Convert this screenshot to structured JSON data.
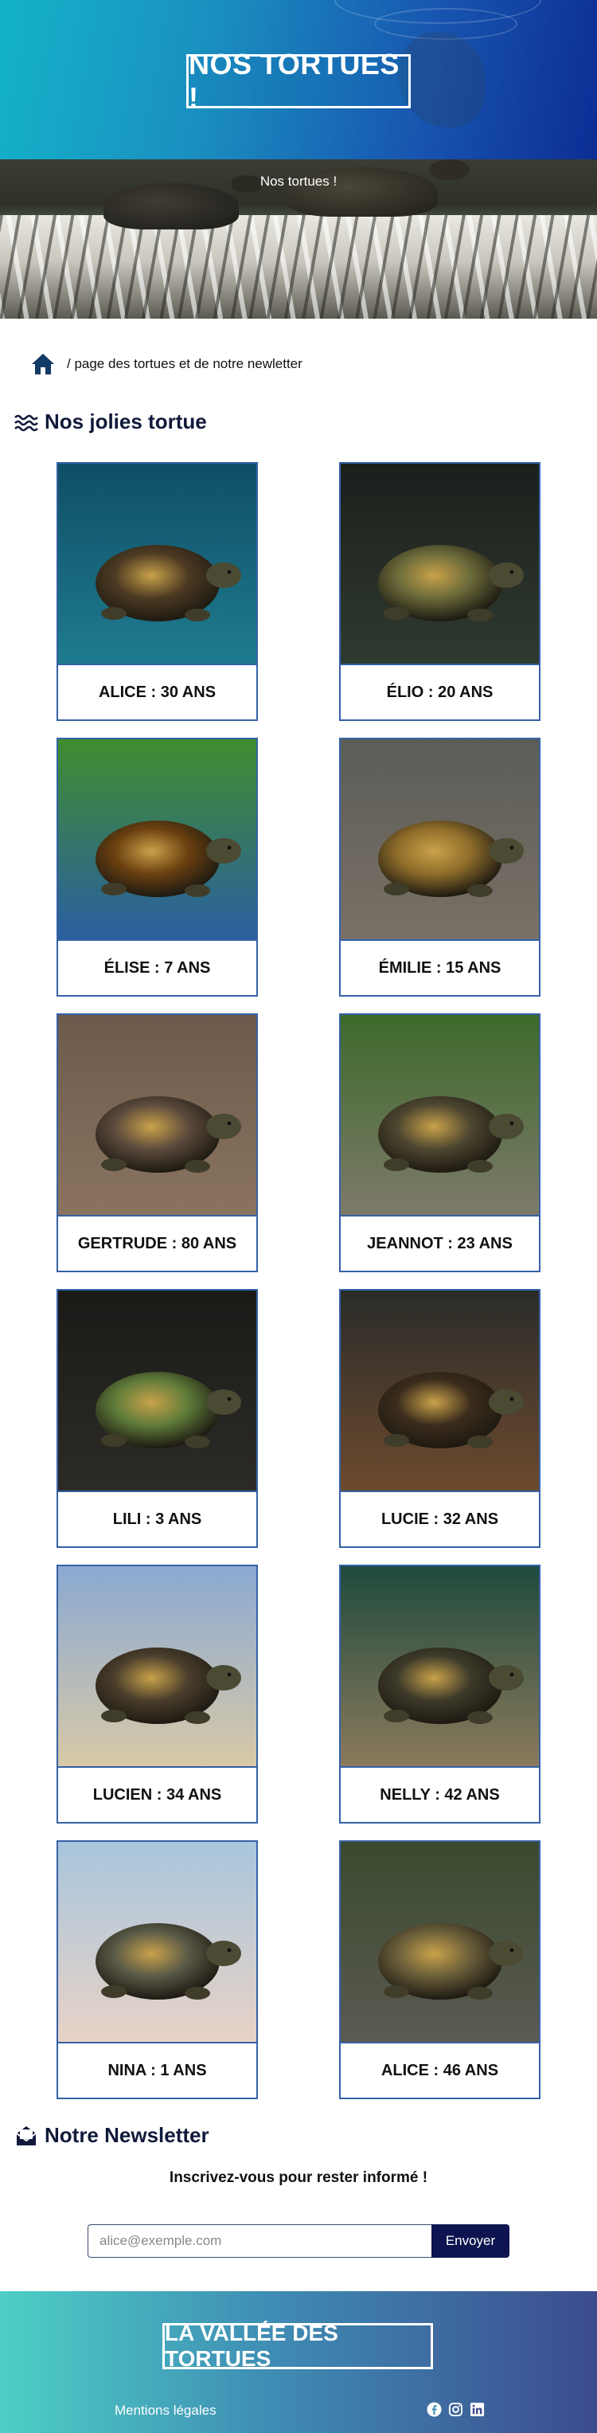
{
  "hero": {
    "title": "NOS TORTUES !"
  },
  "scene": {
    "caption": "Nos tortues !"
  },
  "breadcrumb": {
    "home_icon": "home-icon",
    "text": "/ page des tortues et de notre newletter"
  },
  "turtles_section": {
    "title": "Nos jolies tortue",
    "icon": "waves-icon",
    "cards": [
      {
        "caption": "ALICE : 30 ANS",
        "palette": [
          "#0f4f66",
          "#1f7b8f",
          "#4d3a22"
        ]
      },
      {
        "caption": "ÉLIO : 20 ANS",
        "palette": [
          "#1c1f1c",
          "#2f3a30",
          "#6a6a3a"
        ]
      },
      {
        "caption": "ÉLISE : 7 ANS",
        "palette": [
          "#3f8d2f",
          "#2a5fa0",
          "#6b4010"
        ]
      },
      {
        "caption": "ÉMILIE : 15 ANS",
        "palette": [
          "#5b5d58",
          "#7a7066",
          "#8f6d2a"
        ]
      },
      {
        "caption": "GERTRUDE : 80 ANS",
        "palette": [
          "#6d5a4c",
          "#8a7460",
          "#5c4a3d"
        ]
      },
      {
        "caption": "JEANNOT : 23 ANS",
        "palette": [
          "#3c6a2a",
          "#7e7a6a",
          "#4d4630"
        ]
      },
      {
        "caption": "LILI : 3 ANS",
        "palette": [
          "#1a1a18",
          "#2c2b26",
          "#5f7c3a"
        ]
      },
      {
        "caption": "LUCIE : 32 ANS",
        "palette": [
          "#2a2c2a",
          "#6d4a2e",
          "#3b2c1c"
        ]
      },
      {
        "caption": "LUCIEN : 34 ANS",
        "palette": [
          "#8aa9d2",
          "#d8c9a8",
          "#4a3e2c"
        ]
      },
      {
        "caption": "NELLY : 42 ANS",
        "palette": [
          "#1f4a3d",
          "#8b7a5c",
          "#3d3a2a"
        ]
      },
      {
        "caption": "NINA : 1 ANS",
        "palette": [
          "#a8c6dd",
          "#e8d2c6",
          "#5a5a48"
        ]
      },
      {
        "caption": "ALICE : 46 ANS",
        "palette": [
          "#3a4a2e",
          "#5b5a52",
          "#6a5e3a"
        ]
      }
    ]
  },
  "newsletter": {
    "title": "Notre Newsletter",
    "icon": "mail-open-icon",
    "subtitle": "Inscrivez-vous pour rester informé !",
    "placeholder": "alice@exemple.com",
    "button": "Envoyer"
  },
  "footer": {
    "title": "LA VALLÉE DES TORTUES",
    "link": "Mentions légales",
    "socials": [
      "facebook-icon",
      "instagram-icon",
      "linkedin-icon"
    ]
  },
  "colors": {
    "accent": "#0d1450",
    "card_border": "#3562a6",
    "hero_start": "#14b3c9",
    "hero_end": "#0c2d95"
  }
}
